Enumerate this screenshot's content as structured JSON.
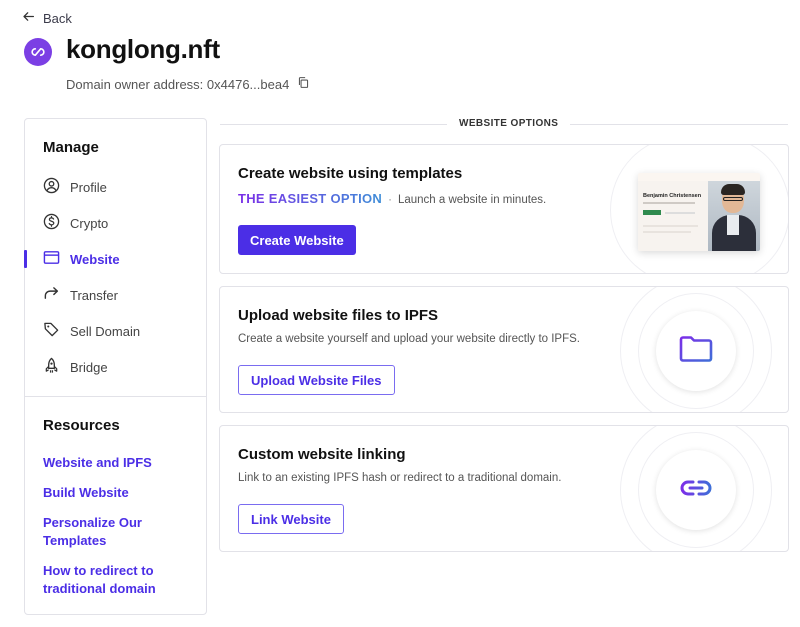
{
  "header": {
    "back_label": "Back",
    "domain_name": "konglong.nft",
    "owner_label": "Domain owner address: 0x4476...bea4"
  },
  "sidebar": {
    "manage_heading": "Manage",
    "items": [
      {
        "label": "Profile",
        "icon": "person-circle-icon",
        "active": false
      },
      {
        "label": "Crypto",
        "icon": "dollar-coin-icon",
        "active": false
      },
      {
        "label": "Website",
        "icon": "browser-window-icon",
        "active": true
      },
      {
        "label": "Transfer",
        "icon": "arrow-forward-icon",
        "active": false
      },
      {
        "label": "Sell Domain",
        "icon": "tag-icon",
        "active": false
      },
      {
        "label": "Bridge",
        "icon": "rocket-icon",
        "active": false
      }
    ],
    "resources_heading": "Resources",
    "resources": [
      {
        "label": "Website and IPFS"
      },
      {
        "label": "Build Website"
      },
      {
        "label": "Personalize Our Templates"
      },
      {
        "label": "How to redirect to traditional domain"
      }
    ]
  },
  "main": {
    "section_label": "WEBSITE OPTIONS",
    "cards": [
      {
        "title": "Create website using templates",
        "tag": "THE EASIEST OPTION",
        "description": "Launch a website in minutes.",
        "button_label": "Create Website",
        "preview_name": "Benjamin Christensen"
      },
      {
        "title": "Upload website files to IPFS",
        "description": "Create a website yourself and upload your website directly to IPFS.",
        "button_label": "Upload Website Files",
        "icon": "folder-icon"
      },
      {
        "title": "Custom website linking",
        "description": "Link to an existing IPFS hash or redirect to a traditional domain.",
        "button_label": "Link Website",
        "icon": "link-icon"
      }
    ]
  },
  "colors": {
    "accent": "#4b2ee6",
    "domain_logo": "#7b3fe4",
    "gradient_start": "#7b2ee8",
    "gradient_end": "#3f8ed8"
  }
}
